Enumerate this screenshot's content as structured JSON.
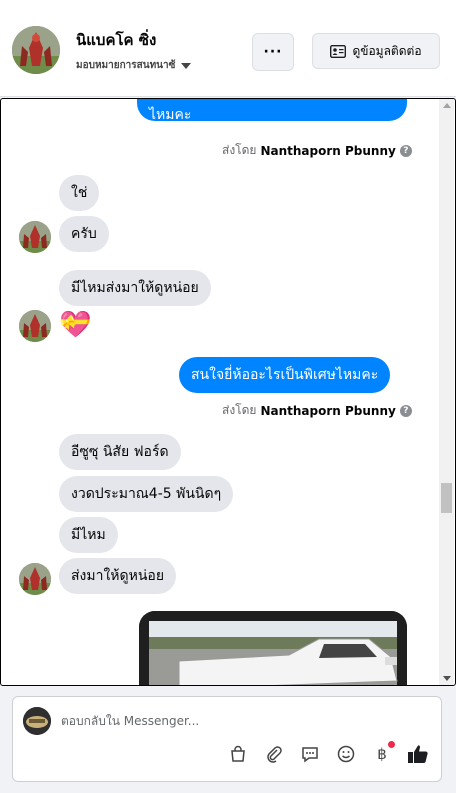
{
  "header": {
    "name": "นิแบคโค ซิ่ง",
    "subtitle": "มอบหมายการสนทนาซ้",
    "more_label": "···",
    "contact_label": "ดูข้อมูลติดต่อ"
  },
  "messages": [
    {
      "dir": "out",
      "text": "ไหมคะ"
    },
    {
      "sent_by_prefix": "ส่งโดย",
      "sent_by_name": "Nanthaporn Pbunny"
    },
    {
      "dir": "in",
      "text": "ใช่"
    },
    {
      "dir": "in",
      "text": "ครับ"
    },
    {
      "dir": "in",
      "text": "มีไหมส่งมาให้ดูหน่อย"
    },
    {
      "dir": "in",
      "text": "💝"
    },
    {
      "dir": "out",
      "text": "สนใจยี่ห้ออะไรเป็นพิเศษไหมคะ"
    },
    {
      "sent_by_prefix": "ส่งโดย",
      "sent_by_name": "Nanthaporn Pbunny"
    },
    {
      "dir": "in",
      "text": "อีซูซุ นิสัย ฟอร์ด"
    },
    {
      "dir": "in",
      "text": "งวดประมาณ4-5 พันนิดๆ"
    },
    {
      "dir": "in",
      "text": "มีไหม"
    },
    {
      "dir": "in",
      "text": "ส่งมาให้ดูหน่อย"
    }
  ],
  "composer": {
    "placeholder": "ตอบกลับใน Messenger...",
    "tools": [
      "shopping-bag-icon",
      "paperclip-icon",
      "chat-bubble-icon",
      "smiley-icon",
      "baht-icon",
      "thumbs-up-icon"
    ]
  },
  "colors": {
    "outgoing": "#0084ff",
    "incoming": "#e4e6eb",
    "like": "#1c1e21"
  }
}
